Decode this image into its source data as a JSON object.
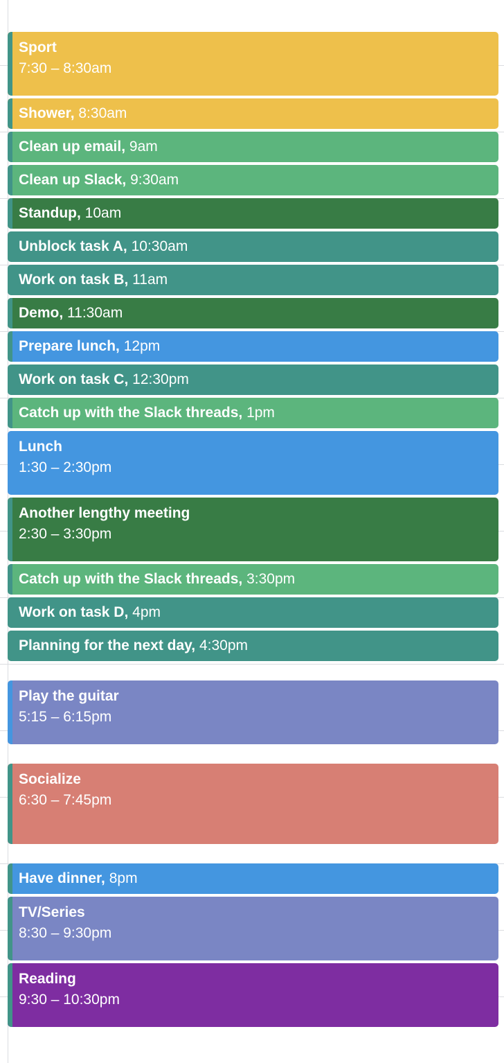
{
  "calendar": {
    "colors": {
      "banana": "#eec04b",
      "sage": "#5cb57d",
      "basil": "#387c45",
      "peacock": "#419488",
      "blueberry": "#4496e0",
      "lavender": "#7a86c4",
      "flamingo": "#d77f74",
      "grape": "#7e2da1"
    },
    "events": [
      {
        "title": "Sport",
        "time": "7:30 – 8:30am",
        "color": "#eec04b",
        "stripe": "#419488"
      },
      {
        "title": "Shower,",
        "time": "8:30am",
        "color": "#eec04b",
        "stripe": "#419488"
      },
      {
        "title": "Clean up email,",
        "time": "9am",
        "color": "#5cb57d",
        "stripe": "#419488"
      },
      {
        "title": "Clean up Slack,",
        "time": "9:30am",
        "color": "#5cb57d",
        "stripe": "#419488"
      },
      {
        "title": "Standup,",
        "time": "10am",
        "color": "#387c45",
        "stripe": "#419488"
      },
      {
        "title": "Unblock task A,",
        "time": "10:30am",
        "color": "#419488",
        "stripe": "#419488"
      },
      {
        "title": "Work on task B,",
        "time": "11am",
        "color": "#419488",
        "stripe": "#419488"
      },
      {
        "title": "Demo,",
        "time": "11:30am",
        "color": "#387c45",
        "stripe": "#419488"
      },
      {
        "title": "Prepare lunch,",
        "time": "12pm",
        "color": "#4496e0",
        "stripe": "#419488"
      },
      {
        "title": "Work on task C,",
        "time": "12:30pm",
        "color": "#419488",
        "stripe": "#419488"
      },
      {
        "title": "Catch up with the Slack threads,",
        "time": "1pm",
        "color": "#5cb57d",
        "stripe": "#419488"
      },
      {
        "title": "Lunch",
        "time": "1:30 – 2:30pm",
        "color": "#4496e0",
        "stripe": "#4496e0"
      },
      {
        "title": "Another lengthy meeting",
        "time": "2:30 – 3:30pm",
        "color": "#387c45",
        "stripe": "#419488"
      },
      {
        "title": "Catch up with the Slack threads,",
        "time": "3:30pm",
        "color": "#5cb57d",
        "stripe": "#419488"
      },
      {
        "title": "Work on task D,",
        "time": "4pm",
        "color": "#419488",
        "stripe": "#419488"
      },
      {
        "title": "Planning for the next day,",
        "time": "4:30pm",
        "color": "#419488",
        "stripe": "#419488"
      },
      {
        "title": "Play the guitar",
        "time": "5:15 – 6:15pm",
        "color": "#7a86c4",
        "stripe": "#4496e0"
      },
      {
        "title": "Socialize",
        "time": "6:30 – 7:45pm",
        "color": "#d77f74",
        "stripe": "#419488"
      },
      {
        "title": "Have dinner,",
        "time": "8pm",
        "color": "#4496e0",
        "stripe": "#419488"
      },
      {
        "title": "TV/Series",
        "time": "8:30 – 9:30pm",
        "color": "#7a86c4",
        "stripe": "#419488"
      },
      {
        "title": "Reading",
        "time": "9:30 – 10:30pm",
        "color": "#7e2da1",
        "stripe": "#419488"
      }
    ]
  }
}
